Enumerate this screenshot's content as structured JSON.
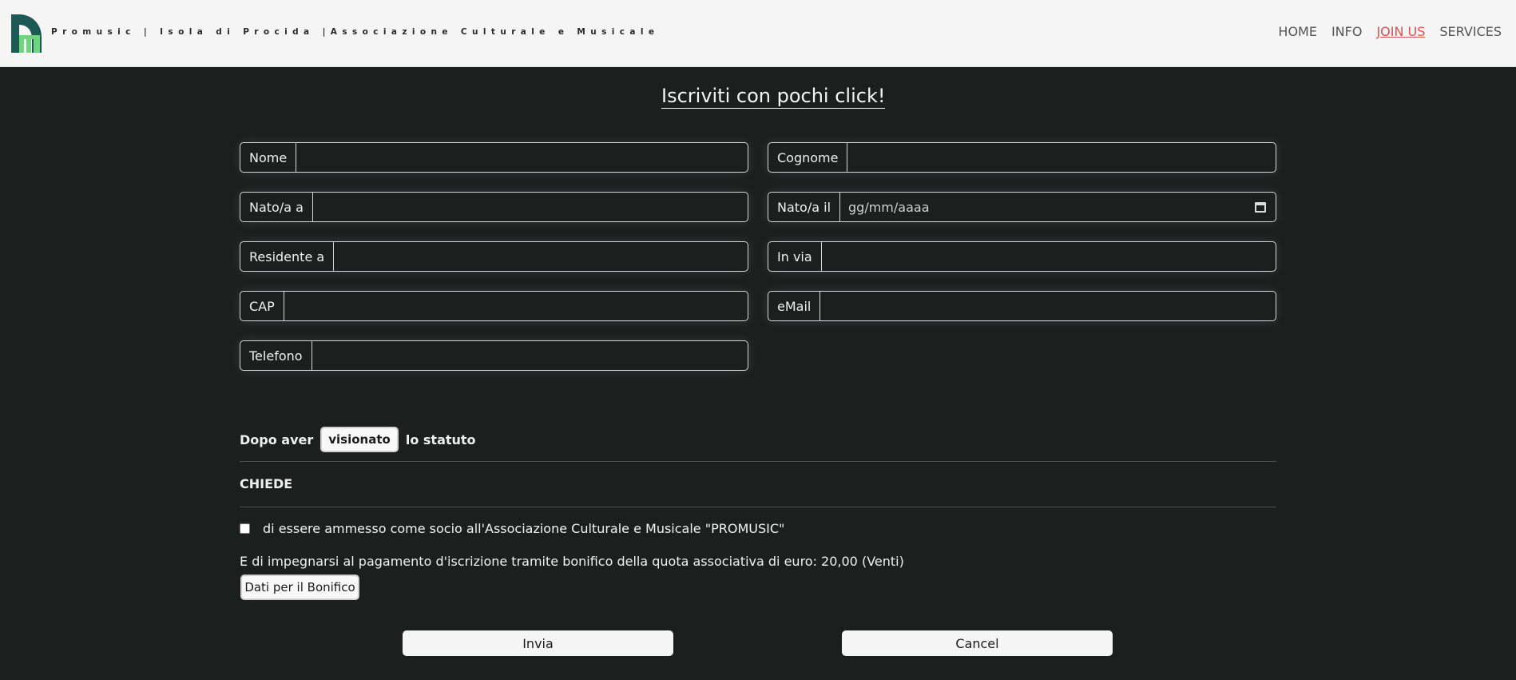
{
  "header": {
    "brand": "Promusic | Isola di Procida |Associazione Culturale e Musicale",
    "nav": [
      {
        "label": "HOME",
        "active": false
      },
      {
        "label": "INFO",
        "active": false
      },
      {
        "label": "JOIN US",
        "active": true
      },
      {
        "label": "SERVICES",
        "active": false
      }
    ],
    "logo_icon": "promusic-logo",
    "active_color": "#d9534f"
  },
  "form": {
    "title": "Iscriviti con pochi click!",
    "fields": {
      "nome": {
        "label": "Nome",
        "value": ""
      },
      "cognome": {
        "label": "Cognome",
        "value": ""
      },
      "nato_a": {
        "label": "Nato/a a",
        "value": ""
      },
      "nato_il": {
        "label": "Nato/a il",
        "placeholder": "gg/mm/aaaa"
      },
      "residente": {
        "label": "Residente a",
        "value": ""
      },
      "via": {
        "label": "In via",
        "value": ""
      },
      "cap": {
        "label": "CAP",
        "value": ""
      },
      "email": {
        "label": "eMail",
        "value": ""
      },
      "telefono": {
        "label": "Telefono",
        "value": ""
      }
    },
    "statuto": {
      "before": "Dopo aver",
      "button": "visionato",
      "after": "lo statuto"
    },
    "chiede": "CHIEDE",
    "checkbox_label": "di essere ammesso come socio all'Associazione Culturale e Musicale \"PROMUSIC\"",
    "checkbox_checked": false,
    "payment_text": "E di impegnarsi al pagamento d'iscrizione tramite bonifico della quota associativa di euro: 20,00 (Venti)",
    "bonifico_button": "Dati per il Bonifico",
    "submit_button": "Invia",
    "cancel_button": "Cancel"
  },
  "colors": {
    "background": "#1b201f",
    "header_background": "#f5f5f5"
  }
}
